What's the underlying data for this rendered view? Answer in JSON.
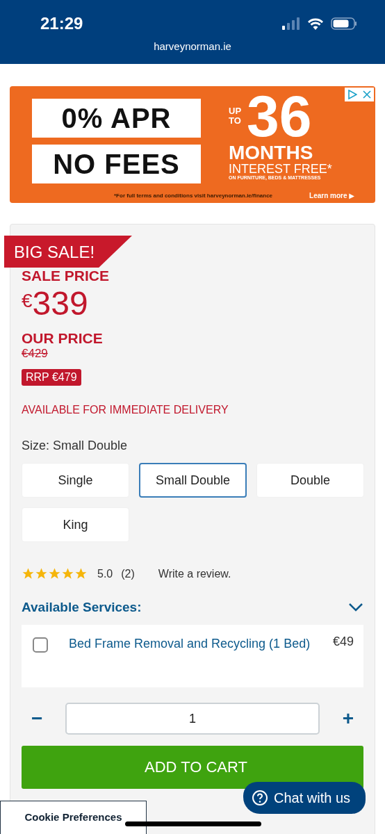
{
  "status_bar": {
    "time": "21:29",
    "url": "harveynorman.ie"
  },
  "ad": {
    "line_1": "0% APR",
    "line_2": "NO FEES",
    "up_to": "UP TO",
    "number": "36",
    "months": "MONTHS",
    "interest": "INTEREST FREE*",
    "scope": "ON FURNITURE, BEDS & MATTRESSES",
    "terms": "*For full terms and conditions visit harveynorman.ie/finance",
    "learn_more": "Learn more ▶"
  },
  "product": {
    "ribbon": "BIG SALE!",
    "sale_label": "SALE PRICE",
    "currency": "€",
    "sale_price": "339",
    "our_price_label": "OUR PRICE",
    "our_price": "€429",
    "rrp": "RRP €479",
    "availability": "AVAILABLE FOR IMMEDIATE DELIVERY",
    "size_label": "Size: Small Double",
    "sizes": [
      {
        "label": "Single",
        "selected": false
      },
      {
        "label": "Small Double",
        "selected": true
      },
      {
        "label": "Double",
        "selected": false
      },
      {
        "label": "King",
        "selected": false
      }
    ],
    "rating": {
      "stars": 5,
      "score": "5.0",
      "count": "(2)",
      "write_review": "Write a review."
    },
    "services": {
      "title": "Available Services:",
      "expanded": true,
      "items": [
        {
          "name": "Bed Frame Removal and Recycling (1 Bed)",
          "price": "€49",
          "checked": false
        }
      ]
    },
    "quantity": {
      "minus": "−",
      "value": "1",
      "plus": "+"
    },
    "add_to_cart": "ADD TO CART"
  },
  "chat": {
    "label": "Chat with us"
  },
  "cookie": {
    "label": "Cookie Preferences"
  }
}
